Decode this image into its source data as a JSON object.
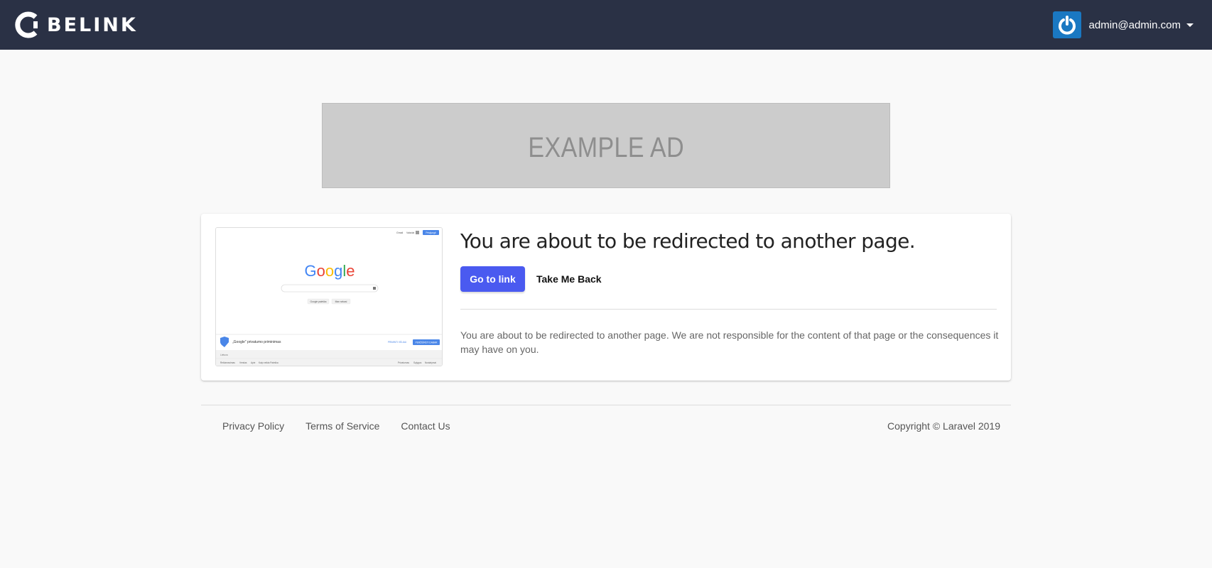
{
  "header": {
    "brand": "BELINK",
    "user_email": "admin@admin.com"
  },
  "ad": {
    "text": "EXAMPLE AD"
  },
  "redirect": {
    "title": "You are about to be redirected to another page.",
    "go_label": "Go to link",
    "back_label": "Take Me Back",
    "message": "You are about to be redirected to another page. We are not responsible for the content of that page or the consequences it may have on you.",
    "preview": {
      "logo_text": "Google",
      "top_links": [
        "Gmail",
        "Vaizdai"
      ],
      "signin_label": "Prisijungti",
      "search_buttons": [
        "Google paieška",
        "Man sekasi"
      ],
      "privacy_text": "„Google\" privatumo priminimas",
      "privacy_later": "PRIMINTI VĖLIAU",
      "privacy_review": "PERŽIŪRĖTI DABAR",
      "country": "Lietuva",
      "footer_left": [
        "Reklamavimas",
        "Verslas",
        "Apie",
        "Kaip veikia Paieška"
      ],
      "footer_right": [
        "Privatumas",
        "Sąlygos",
        "Nustatymai"
      ]
    }
  },
  "footer": {
    "links": [
      "Privacy Policy",
      "Terms of Service",
      "Contact Us"
    ],
    "copyright": "Copyright © Laravel 2019"
  },
  "colors": {
    "navbar": "#2a3145",
    "primary_button": "#4a5af0",
    "avatar": "#1a78c2",
    "ad_background": "#cccccc"
  }
}
